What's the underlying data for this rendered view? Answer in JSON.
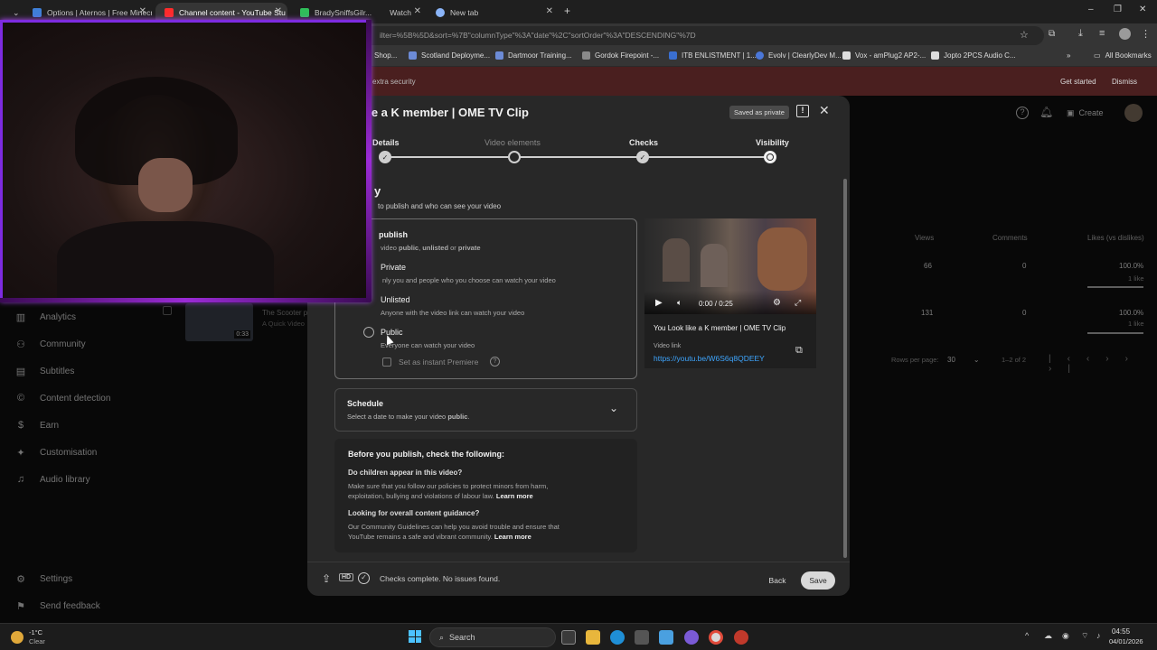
{
  "browser": {
    "tabs": [
      {
        "title": "Options | Aternos | Free Minecra",
        "color": "#3f7fd8"
      },
      {
        "title": "Channel content - YouTube Stu",
        "color": "#ff2b2b"
      },
      {
        "title": "BradySniffsGilr...",
        "color": "#2fbf5a"
      },
      {
        "title": "Watch",
        "color": "#ff2b2b"
      },
      {
        "title": "New tab",
        "color": "#8ab4f8"
      }
    ],
    "url_fragment": "ilter=%5B%5D&sort=%7B\"columnType\"%3A\"date\"%2C\"sortOrder\"%3A\"DESCENDING\"%7D",
    "bookmarks": [
      "Shop...",
      "Scotland Deployme...",
      "Dartmoor Training...",
      "Gordok Firepoint -...",
      "ITB ENLISTMENT | 1...",
      "Evolv | ClearlyDev M...",
      "Vox - amPlug2 AP2-...",
      "Jopto 2PCS Audio C..."
    ],
    "all_bookmarks": "All Bookmarks",
    "notice": {
      "text": "extra security",
      "get_started": "Get started",
      "dismiss": "Dismiss"
    }
  },
  "studio": {
    "create": "Create",
    "sidebar": [
      "Analytics",
      "Community",
      "Subtitles",
      "Content detection",
      "Earn",
      "Customisation",
      "Audio library",
      "Settings",
      "Send feedback"
    ],
    "table": {
      "headers": {
        "views": "Views",
        "comments": "Comments",
        "likes": "Likes (vs dislikes)"
      },
      "rows": [
        {
          "views": "66",
          "comments": "0",
          "likes": "100.0%",
          "likes_sub": "1 like"
        },
        {
          "title": "The Scooter p...",
          "desc": "A Quick Video",
          "duration": "0:33",
          "views": "131",
          "comments": "0",
          "likes": "100.0%",
          "likes_sub": "1 like"
        }
      ],
      "rows_per_page_label": "Rows per page:",
      "rows_per_page": "30",
      "range": "1–2 of 2"
    }
  },
  "dialog": {
    "title": "ike a K member | OME TV Clip",
    "saved_chip": "Saved as private",
    "steps": [
      "Details",
      "Video elements",
      "Checks",
      "Visibility"
    ],
    "section_heading": "y",
    "section_sub": "to publish and who can see your video",
    "save_publish": {
      "title": "publish",
      "sub_prefix": "video ",
      "public": "public",
      "sep1": ", ",
      "unlisted": "unlisted",
      "sep2": " or ",
      "private": "private"
    },
    "options": [
      {
        "title": "Private",
        "sub": "nly you and people who you choose can watch your video"
      },
      {
        "title": "Unlisted",
        "sub": "Anyone with the video link can watch your video"
      },
      {
        "title": "Public",
        "sub": "Everyone can watch your video"
      }
    ],
    "premiere": "Set as instant Premiere",
    "schedule": {
      "title": "Schedule",
      "sub_prefix": "Select a date to make your video ",
      "sub_bold": "public",
      "sub_suffix": "."
    },
    "checklist": {
      "heading": "Before you publish, check the following:",
      "q1": "Do children appear in this video?",
      "a1_line1": "Make sure that you follow our policies to protect minors from harm,",
      "a1_line2": "exploitation, bullying and violations of labour law.",
      "learn_more": "Learn more",
      "q2": "Looking for overall content guidance?",
      "a2_line1": "Our Community Guidelines can help you avoid trouble and ensure that",
      "a2_line2": "YouTube remains a safe and vibrant community."
    },
    "preview": {
      "time": "0:00 / 0:25",
      "title": "You Look like a K member | OME TV Clip",
      "link_label": "Video link",
      "link": "https://youtu.be/W6S6q8QDEEY"
    },
    "footer": {
      "status": "Checks complete. No issues found.",
      "back": "Back",
      "save": "Save"
    }
  },
  "taskbar": {
    "weather_temp": "-1°C",
    "weather_desc": "Clear",
    "search": "Search",
    "time": "04:55",
    "date": "04/01/2026"
  }
}
